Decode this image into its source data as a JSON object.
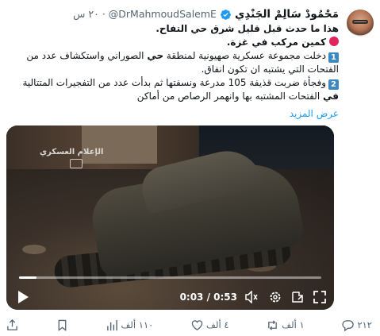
{
  "author": {
    "display_name": "مَحْمُودْ سَالِمْ الجَنْدِي",
    "handle": "@DrMahmoudSalemE",
    "separator": "·",
    "time": "٢٠ س"
  },
  "post": {
    "line1": "هذا ما حدث قبل قليل شرق حي التفاح.",
    "line2": "كمين مركب في غزة.",
    "badge1": "1",
    "line3a": "دخلت مجموعة عسكرية صهيونية لمنطقة ",
    "line3b": "حي",
    "line3c": " الصوراني واستكشاف عدد من",
    "line4": "الفتحات التي يشتبه ان تكون انفاق.",
    "badge2": "2",
    "line5": "وفجأة ضربت قذيفة 105 مدرعة ونسفتها ثم بدأت عدد من التفجيرات المتتالية",
    "line6a": "في",
    "line6b": " الفتحات المشتبه بها وانهمر الرصاص من أماكن",
    "show_more": "عرض المزيد"
  },
  "video": {
    "watermark": "الإعلام العسكري",
    "time_readout": "0:03 / 0:53",
    "progress_fraction": 0.057,
    "icons": [
      "play-icon",
      "volume-icon",
      "settings-icon",
      "picture-in-picture-icon",
      "fullscreen-icon"
    ]
  },
  "actions": {
    "replies": "٢١٢",
    "retweets": "١ ألف",
    "likes": "٤ ألف",
    "views": "١١٠ ألف",
    "icons": [
      "reply-icon",
      "retweet-icon",
      "like-icon",
      "views-icon",
      "bookmark-icon",
      "share-icon"
    ]
  },
  "colors": {
    "verified": "#1d9bf0",
    "link": "#1d9bf0",
    "muted": "#536471",
    "red_dot": "#e0245e",
    "badge_blue": "#3b88c3"
  }
}
